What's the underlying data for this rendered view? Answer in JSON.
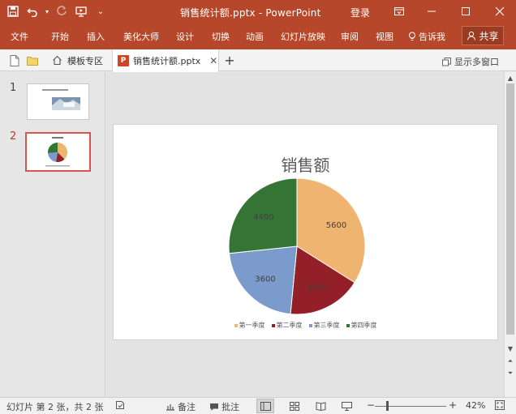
{
  "window": {
    "title": "销售统计额.pptx - PowerPoint",
    "login": "登录"
  },
  "menu": {
    "items": [
      "文件",
      "开始",
      "插入",
      "美化大师",
      "设计",
      "切换",
      "动画",
      "幻灯片放映",
      "审阅",
      "视图"
    ],
    "tell_me": "告诉我",
    "share": "共享"
  },
  "tabs": {
    "home_label": "模板专区",
    "doc_label": "销售统计额.pptx",
    "doc_badge": "P",
    "multi_window": "显示多窗口"
  },
  "thumbnails": [
    {
      "number": "1"
    },
    {
      "number": "2"
    }
  ],
  "slide": {
    "title": "销售额"
  },
  "chart_data": {
    "type": "pie",
    "title": "销售额",
    "categories": [
      "第一季度",
      "第二季度",
      "第三季度",
      "第四季度"
    ],
    "values": [
      5600,
      2900,
      3600,
      4400
    ],
    "colors": [
      "#efb570",
      "#931f28",
      "#7b9bcc",
      "#347535"
    ],
    "data_labels": [
      "5600",
      "2900",
      "3600",
      "4400"
    ],
    "legend_position": "bottom"
  },
  "status": {
    "slide_info": "幻灯片 第 2 张，共 2 张",
    "notes": "备注",
    "comments": "批注",
    "zoom": "42%"
  },
  "colors": {
    "accent": "#b7472a"
  }
}
